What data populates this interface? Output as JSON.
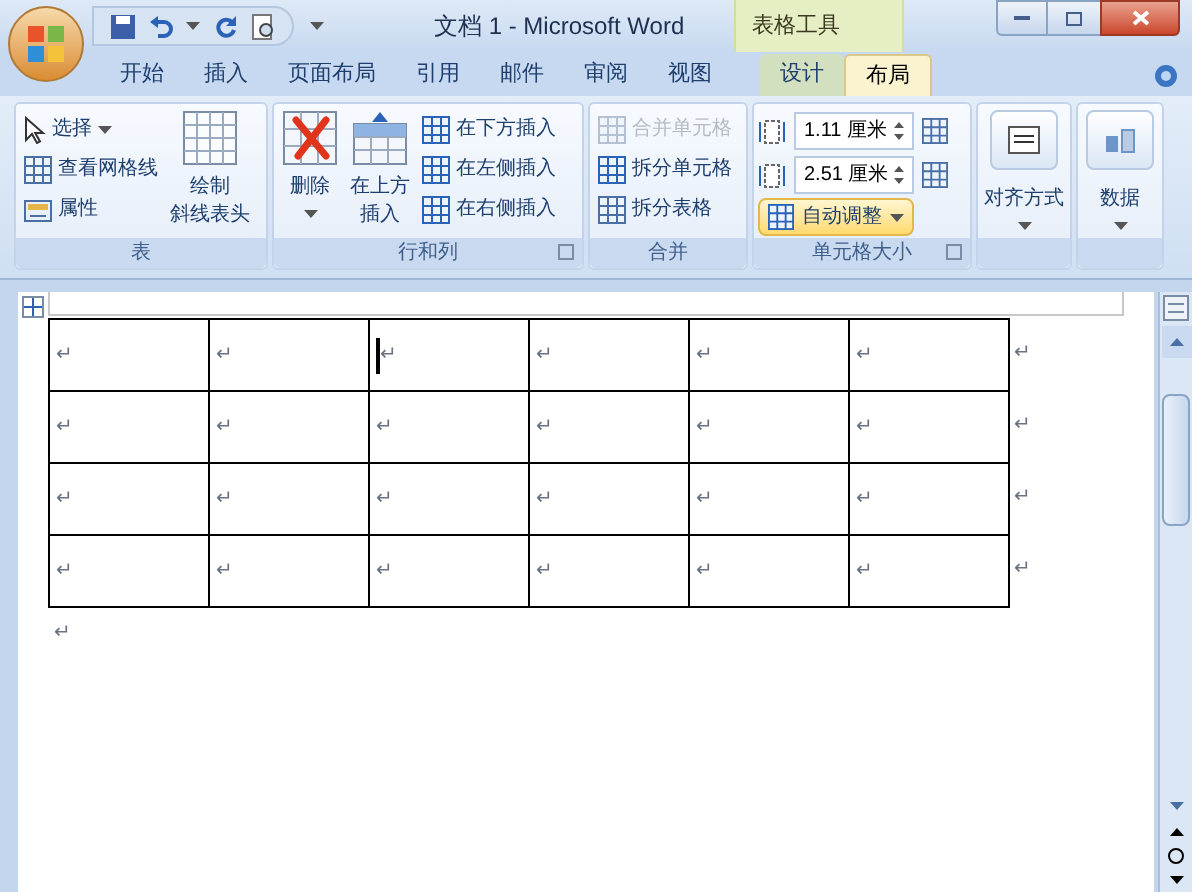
{
  "window": {
    "title": "文档 1 - Microsoft Word",
    "context_title": "表格工具"
  },
  "tabs": [
    {
      "label": "开始",
      "selected": false,
      "contextual": false
    },
    {
      "label": "插入",
      "selected": false,
      "contextual": false
    },
    {
      "label": "页面布局",
      "selected": false,
      "contextual": false
    },
    {
      "label": "引用",
      "selected": false,
      "contextual": false
    },
    {
      "label": "邮件",
      "selected": false,
      "contextual": false
    },
    {
      "label": "审阅",
      "selected": false,
      "contextual": false
    },
    {
      "label": "视图",
      "selected": false,
      "contextual": false
    },
    {
      "label": "设计",
      "selected": false,
      "contextual": true
    },
    {
      "label": "布局",
      "selected": true,
      "contextual": true
    }
  ],
  "ribbon": [
    {
      "label": "表",
      "launcher": false,
      "items": [
        {
          "kind": "small",
          "label": "选择",
          "dropdown": true,
          "disabled": false
        },
        {
          "kind": "small",
          "label": "查看网格线",
          "dropdown": false,
          "disabled": false
        },
        {
          "kind": "small",
          "label": "属性",
          "dropdown": false,
          "disabled": false
        },
        {
          "kind": "large",
          "lines": [
            "绘制",
            "斜线表头"
          ],
          "dropdown": false
        }
      ]
    },
    {
      "label": "行和列",
      "launcher": true,
      "items": [
        {
          "kind": "large",
          "lines": [
            "删除"
          ],
          "dropdown": true
        },
        {
          "kind": "large",
          "lines": [
            "在上方",
            "插入"
          ],
          "dropdown": false
        },
        {
          "kind": "small",
          "label": "在下方插入",
          "dropdown": false,
          "disabled": false
        },
        {
          "kind": "small",
          "label": "在左侧插入",
          "dropdown": false,
          "disabled": false
        },
        {
          "kind": "small",
          "label": "在右侧插入",
          "dropdown": false,
          "disabled": false
        }
      ]
    },
    {
      "label": "合并",
      "launcher": false,
      "items": [
        {
          "kind": "small",
          "label": "合并单元格",
          "dropdown": false,
          "disabled": true
        },
        {
          "kind": "small",
          "label": "拆分单元格",
          "dropdown": false,
          "disabled": false
        },
        {
          "kind": "small",
          "label": "拆分表格",
          "dropdown": false,
          "disabled": false
        }
      ]
    },
    {
      "label": "单元格大小",
      "launcher": true,
      "items": [
        {
          "kind": "spinner",
          "value": "1.11 厘米"
        },
        {
          "kind": "spinner",
          "value": "2.51 厘米"
        },
        {
          "kind": "split",
          "label": "自动调整",
          "dropdown": true
        }
      ]
    },
    {
      "launcher": false,
      "items": [
        {
          "kind": "large",
          "lines": [
            "对齐方式"
          ],
          "dropdown": true
        }
      ]
    },
    {
      "launcher": false,
      "items": [
        {
          "kind": "large",
          "lines": [
            "数据"
          ],
          "dropdown": true
        }
      ]
    }
  ],
  "table": {
    "rows": [
      {
        "cells": [
          {
            "mark": "↵",
            "caret": false
          },
          {
            "mark": "↵",
            "caret": false
          },
          {
            "mark": "↵",
            "caret": true
          },
          {
            "mark": "↵",
            "caret": false
          },
          {
            "mark": "↵",
            "caret": false
          },
          {
            "mark": "↵",
            "caret": false
          }
        ],
        "end_mark": "↵"
      },
      {
        "cells": [
          {
            "mark": "↵",
            "caret": false
          },
          {
            "mark": "↵",
            "caret": false
          },
          {
            "mark": "↵",
            "caret": false
          },
          {
            "mark": "↵",
            "caret": false
          },
          {
            "mark": "↵",
            "caret": false
          },
          {
            "mark": "↵",
            "caret": false
          }
        ],
        "end_mark": "↵"
      },
      {
        "cells": [
          {
            "mark": "↵",
            "caret": false
          },
          {
            "mark": "↵",
            "caret": false
          },
          {
            "mark": "↵",
            "caret": false
          },
          {
            "mark": "↵",
            "caret": false
          },
          {
            "mark": "↵",
            "caret": false
          },
          {
            "mark": "↵",
            "caret": false
          }
        ],
        "end_mark": "↵"
      },
      {
        "cells": [
          {
            "mark": "↵",
            "caret": false
          },
          {
            "mark": "↵",
            "caret": false
          },
          {
            "mark": "↵",
            "caret": false
          },
          {
            "mark": "↵",
            "caret": false
          },
          {
            "mark": "↵",
            "caret": false
          },
          {
            "mark": "↵",
            "caret": false
          }
        ],
        "end_mark": "↵"
      }
    ]
  },
  "paragraph_mark": "↵"
}
